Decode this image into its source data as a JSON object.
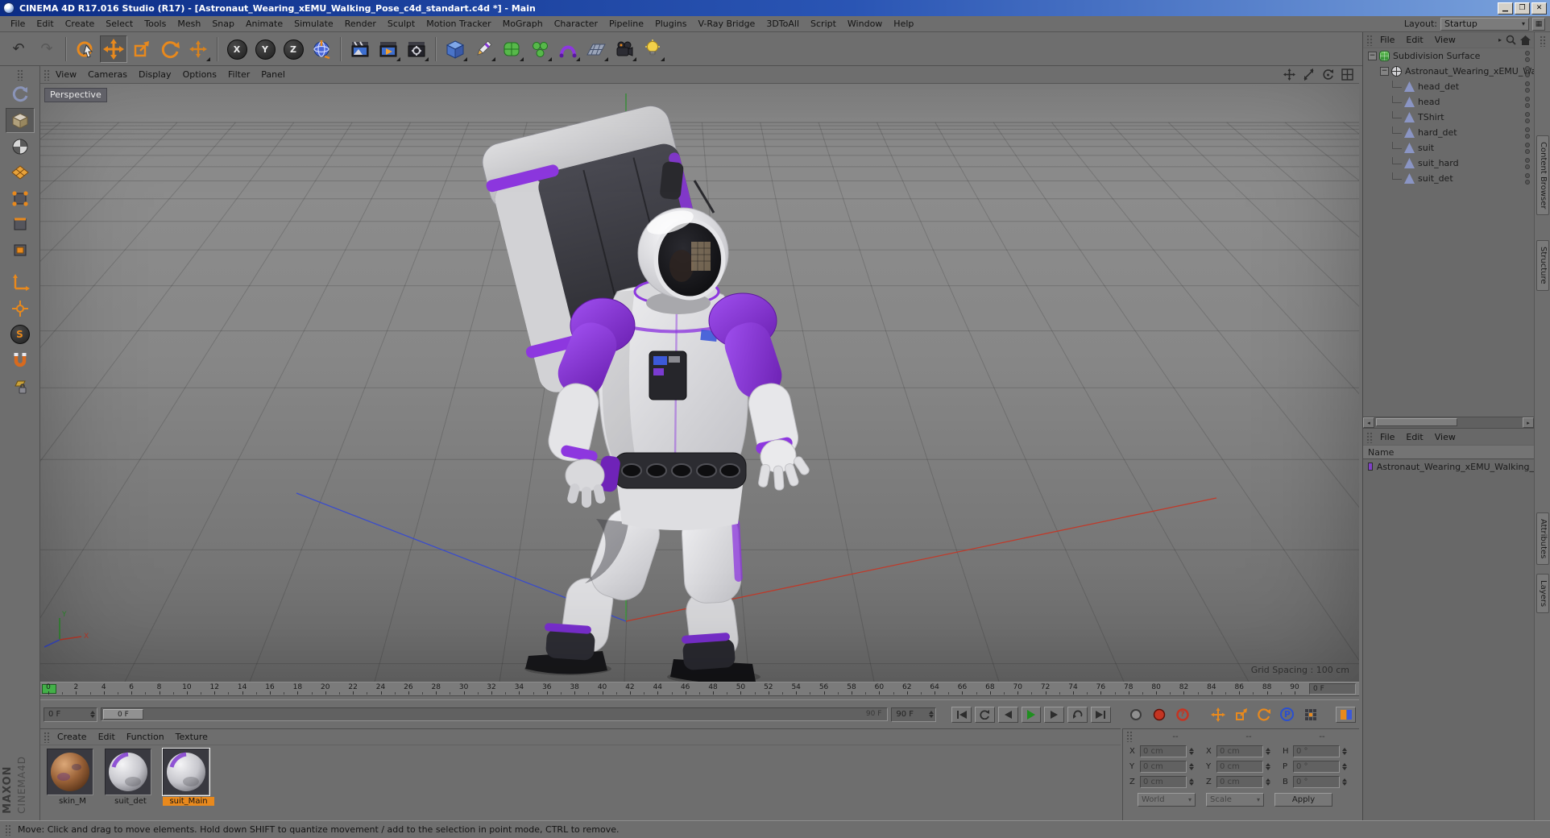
{
  "window": {
    "title": "CINEMA 4D R17.016 Studio (R17) - [Astronaut_Wearing_xEMU_Walking_Pose_c4d_standart.c4d *] - Main"
  },
  "menu_bar": {
    "items": [
      "File",
      "Edit",
      "Create",
      "Select",
      "Tools",
      "Mesh",
      "Snap",
      "Animate",
      "Simulate",
      "Render",
      "Sculpt",
      "Motion Tracker",
      "MoGraph",
      "Character",
      "Pipeline",
      "Plugins",
      "V-Ray Bridge",
      "3DToAll",
      "Script",
      "Window",
      "Help"
    ],
    "layout_label": "Layout:",
    "layout_value": "Startup"
  },
  "toolbar": {
    "axis_buttons": [
      "X",
      "Y",
      "Z"
    ]
  },
  "left_toolbar": {
    "solo_label": "S"
  },
  "viewport": {
    "menu": [
      "View",
      "Cameras",
      "Display",
      "Options",
      "Filter",
      "Panel"
    ],
    "camera_label": "Perspective",
    "grid_spacing_label": "Grid Spacing : 100 cm",
    "gizmo": {
      "x": "X",
      "y": "Y",
      "z": "Z"
    }
  },
  "timeline": {
    "ticks": [
      "0",
      "2",
      "4",
      "6",
      "8",
      "10",
      "12",
      "14",
      "16",
      "18",
      "20",
      "22",
      "24",
      "26",
      "28",
      "30",
      "32",
      "34",
      "36",
      "38",
      "40",
      "42",
      "44",
      "46",
      "48",
      "50",
      "52",
      "54",
      "56",
      "58",
      "60",
      "62",
      "64",
      "66",
      "68",
      "70",
      "72",
      "74",
      "76",
      "78",
      "80",
      "82",
      "84",
      "86",
      "88",
      "90"
    ],
    "current_frame_box": "0 F"
  },
  "transport": {
    "frame_field": "0 F",
    "slider_handle": "0 F",
    "slider_end": "90 F",
    "end_spinner": "90 F",
    "parameter_label": "P",
    "question_label": "?"
  },
  "materials": {
    "menu": [
      "Create",
      "Edit",
      "Function",
      "Texture"
    ],
    "items": [
      {
        "name": "skin_M",
        "type": "skin",
        "selected": false
      },
      {
        "name": "suit_det",
        "type": "suit",
        "selected": false
      },
      {
        "name": "suit_Main",
        "type": "suit",
        "selected": true
      }
    ]
  },
  "coordinates": {
    "headers": [
      "--",
      "--",
      "--"
    ],
    "rows": [
      {
        "cells": [
          [
            "X",
            "0 cm"
          ],
          [
            "X",
            "0 cm"
          ],
          [
            "H",
            "0 °"
          ]
        ]
      },
      {
        "cells": [
          [
            "Y",
            "0 cm"
          ],
          [
            "Y",
            "0 cm"
          ],
          [
            "P",
            "0 °"
          ]
        ]
      },
      {
        "cells": [
          [
            "Z",
            "0 cm"
          ],
          [
            "Z",
            "0 cm"
          ],
          [
            "B",
            "0 °"
          ]
        ]
      }
    ],
    "dropdowns": [
      "World",
      "Scale"
    ],
    "apply_label": "Apply"
  },
  "object_manager": {
    "menu": [
      "File",
      "Edit",
      "View"
    ],
    "tree": [
      {
        "label": "Subdivision Surface",
        "level": 0,
        "expander": true,
        "icon": "subdivision-surface"
      },
      {
        "label": "Astronaut_Wearing_xEMU_Walking",
        "level": 1,
        "expander": true,
        "icon": "null-object"
      },
      {
        "label": "head_det",
        "level": 2,
        "icon": "mesh"
      },
      {
        "label": "head",
        "level": 2,
        "icon": "mesh"
      },
      {
        "label": "TShirt",
        "level": 2,
        "icon": "mesh"
      },
      {
        "label": "hard_det",
        "level": 2,
        "icon": "mesh"
      },
      {
        "label": "suit",
        "level": 2,
        "icon": "mesh"
      },
      {
        "label": "suit_hard",
        "level": 2,
        "icon": "mesh"
      },
      {
        "label": "suit_det",
        "level": 2,
        "icon": "mesh"
      }
    ]
  },
  "layers_panel": {
    "menu": [
      "File",
      "Edit",
      "View"
    ],
    "name_header": "Name",
    "layers": [
      {
        "name": "Astronaut_Wearing_xEMU_Walking_",
        "color": "#8040c8"
      }
    ]
  },
  "side_tabs": {
    "top": [
      "Content Browser",
      "Structure"
    ],
    "bottom": [
      "Attributes",
      "Layers"
    ]
  },
  "status_bar": {
    "text": "Move: Click and drag to move elements. Hold down SHIFT to quantize movement / add to the selection in point mode, CTRL to remove."
  },
  "branding": {
    "maxon": "MAXON",
    "cinema": "CINEMA4D"
  },
  "icons": {
    "undo-icon": "↶",
    "redo-icon": "↷",
    "dropdown-arrow-icon": "▾",
    "expander-collapse-icon": "−"
  },
  "colors": {
    "accent_orange": "#e8891d",
    "accent_purple": "#8534d8",
    "selection_green": "#43b048",
    "titlebar_blue": "#2a55b4"
  }
}
